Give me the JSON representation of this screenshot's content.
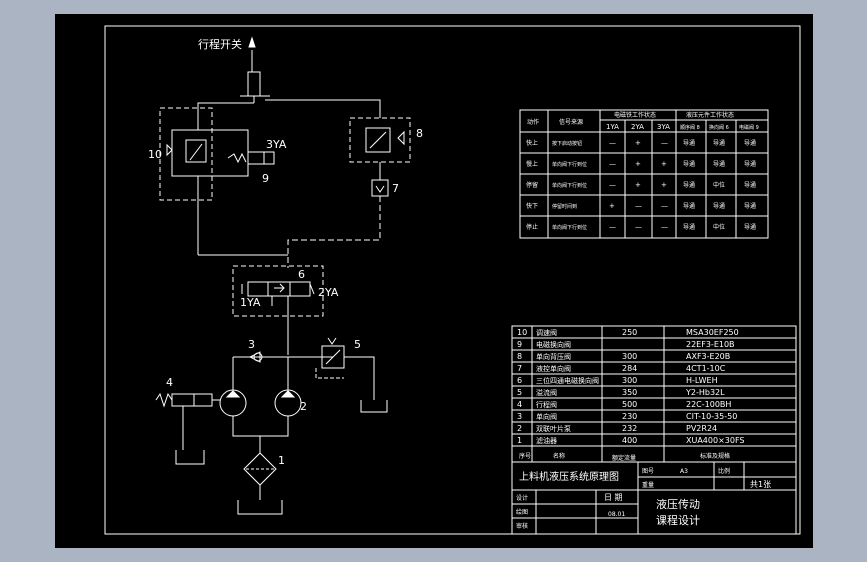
{
  "labels": {
    "travel_switch": "行程开关",
    "n10": "10",
    "n9": "9",
    "n8": "8",
    "n7": "7",
    "n6": "6",
    "n5": "5",
    "n4": "4",
    "n3": "3",
    "n2": "2",
    "n1": "1",
    "sol_3ya": "3YA",
    "sol_1ya": "1YA",
    "sol_2ya": "2YA"
  },
  "action_table": {
    "h_action": "动作",
    "h_signal": "信号来源",
    "h_solenoid": "电磁铁工作状态",
    "h_valve": "液压元件工作状态",
    "sub_1ya": "1YA",
    "sub_2ya": "2YA",
    "sub_3ya": "3YA",
    "sub_v1": "顺序阀 8",
    "sub_v2": "换向阀 6",
    "sub_v3": "电磁阀 9",
    "rows": [
      {
        "action": "快上",
        "signal": "按下启动按钮",
        "s1": "—",
        "s2": "+",
        "s3": "—",
        "v1": "导通",
        "v2": "导通",
        "v3": "导通"
      },
      {
        "action": "慢上",
        "signal": "单向阀下行到位",
        "s1": "—",
        "s2": "+",
        "s3": "+",
        "v1": "导通",
        "v2": "导通",
        "v3": "导通"
      },
      {
        "action": "停留",
        "signal": "单向阀下行到位",
        "s1": "—",
        "s2": "+",
        "s3": "+",
        "v1": "导通",
        "v2": "中位",
        "v3": "导通"
      },
      {
        "action": "快下",
        "signal": "停留时间到",
        "s1": "+",
        "s2": "—",
        "s3": "—",
        "v1": "导通",
        "v2": "导通",
        "v3": "导通"
      },
      {
        "action": "停止",
        "signal": "单向阀下行到位",
        "s1": "—",
        "s2": "—",
        "s3": "—",
        "v1": "导通",
        "v2": "中位",
        "v3": "导通"
      }
    ]
  },
  "parts_list": {
    "rows": [
      {
        "no": "10",
        "name": "调速阀",
        "qty": "250",
        "model": "MSA30EF250"
      },
      {
        "no": "9",
        "name": "电磁换向阀",
        "qty": "",
        "model": "22EF3-E10B"
      },
      {
        "no": "8",
        "name": "单向背压阀",
        "qty": "300",
        "model": "AXF3-E20B"
      },
      {
        "no": "7",
        "name": "液控单向阀",
        "qty": "284",
        "model": "4CT1-10C"
      },
      {
        "no": "6",
        "name": "三位四通电磁换向阀",
        "qty": "300",
        "model": "H-LWEH"
      },
      {
        "no": "5",
        "name": "溢流阀",
        "qty": "350",
        "model": "Y2-Hb32L"
      },
      {
        "no": "4",
        "name": "行程阀",
        "qty": "500",
        "model": "22C-100BH"
      },
      {
        "no": "3",
        "name": "单向阀",
        "qty": "230",
        "model": "CIT-10-35-50"
      },
      {
        "no": "2",
        "name": "双联叶片泵",
        "qty": "232",
        "model": "PV2R24"
      },
      {
        "no": "1",
        "name": "滤油器",
        "qty": "400",
        "model": "XUA400×30FS"
      }
    ],
    "h_no": "序号",
    "h_name": "名称",
    "h_qty": "额定流量",
    "h_model": "标准及规格"
  },
  "title_block": {
    "drawing_title": "上料机液压系统原理图",
    "label_sheet": "图号",
    "sheet_value": "A3",
    "label_scale": "比例",
    "label_weight": "重量",
    "total_sheets": "共1张",
    "label_design": "设计",
    "label_drawn": "绘图",
    "label_check": "审核",
    "label_date": "日 期",
    "date_value": "08.01",
    "course_line1": "液压传动",
    "course_line2": "课程设计"
  },
  "colors": {
    "background": "#aab4c3",
    "sheet": "#000000",
    "lines": "#ffffff",
    "text": "#ffffff"
  }
}
